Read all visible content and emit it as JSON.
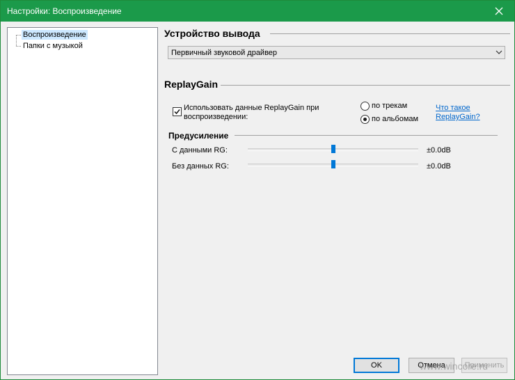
{
  "window": {
    "title": "Настройки: Воспроизведение"
  },
  "tree": {
    "items": [
      {
        "label": "Воспроизведение",
        "selected": true
      },
      {
        "label": "Папки с музыкой",
        "selected": false
      }
    ]
  },
  "output": {
    "heading": "Устройство вывода",
    "device": "Первичный звуковой драйвер"
  },
  "replaygain": {
    "heading": "ReplayGain",
    "use_label": "Использовать данные ReplayGain при воспроизведении:",
    "use_checked": true,
    "radio_tracks": "по трекам",
    "radio_albums": "по альбомам",
    "selected_mode": "по альбомам",
    "link": "Что такое ReplayGain?"
  },
  "preamp": {
    "heading": "Предусиление",
    "with_rg": {
      "label": "С данными RG:",
      "value": "±0.0dB",
      "level_fraction": 0.5
    },
    "without_rg": {
      "label": "Без данных RG:",
      "value": "±0.0dB",
      "level_fraction": 0.5
    }
  },
  "buttons": {
    "ok": "OK",
    "cancel": "Отмена",
    "apply": "Применить"
  },
  "watermark": "www.wincore.ru",
  "colors": {
    "titlebar": "#1b9a4a",
    "accent": "#0078d7",
    "link": "#0066cc"
  },
  "icons": {
    "close": "close-icon",
    "dropdown": "chevron-down-icon"
  }
}
